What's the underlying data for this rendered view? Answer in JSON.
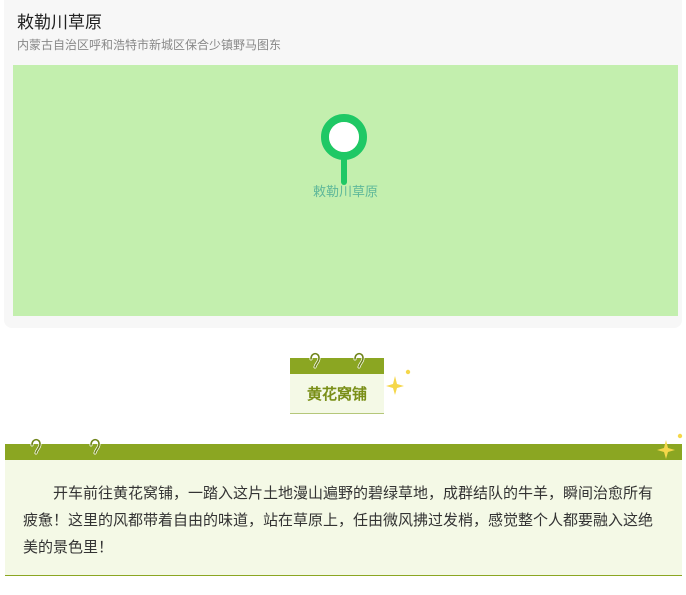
{
  "location": {
    "name": "敕勒川草原",
    "address": "内蒙古自治区呼和浩特市新城区保合少镇野马图东",
    "map_label": "敕勒川草原"
  },
  "section": {
    "title": "黄花窝铺"
  },
  "article": {
    "text": "开车前往黄花窝铺，一踏入这片土地漫山遍野的碧绿草地，成群结队的牛羊，瞬间治愈所有疲惫！这里的风都带着自由的味道，站在草原上，任由微风拂过发梢，感觉整个人都要融入这绝美的景色里！"
  },
  "colors": {
    "accent": "#8ba622",
    "map_bg": "#c3efae",
    "pin": "#1fc865",
    "card_bg": "#f4f9e6",
    "sparkle": "#f5d74a"
  },
  "icons": [
    "map-pin-icon",
    "ring-icon",
    "sparkle-icon"
  ]
}
